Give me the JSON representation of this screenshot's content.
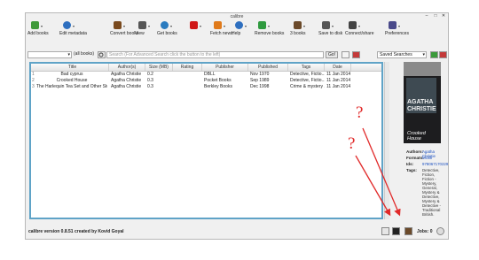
{
  "window": {
    "title": "calibre"
  },
  "toolbar": {
    "items": [
      {
        "label": "Add books",
        "icon": "add-book-icon",
        "color": "#3f9a3a"
      },
      {
        "label": "Edit metadata",
        "icon": "info-icon",
        "color": "#2e6fbf"
      },
      {
        "label": "Convert books",
        "icon": "convert-icon",
        "color": "#7a4a1e"
      },
      {
        "label": "View",
        "icon": "magnifier-icon",
        "color": "#555555"
      },
      {
        "label": "Get books",
        "icon": "globe-icon",
        "color": "#2a7bbf"
      },
      {
        "label": "",
        "icon": "heart-icon",
        "color": "#d01818"
      },
      {
        "label": "Fetch news",
        "icon": "news-icon",
        "color": "#e07a1a"
      },
      {
        "label": "Help",
        "icon": "help-icon",
        "color": "#2e6fbf"
      },
      {
        "label": "Remove books",
        "icon": "recycle-icon",
        "color": "#2f9a3f"
      },
      {
        "label": "3 books",
        "icon": "library-icon",
        "color": "#6b4a2a"
      },
      {
        "label": "Save to disk",
        "icon": "save-icon",
        "color": "#555555"
      },
      {
        "label": "Connect/share",
        "icon": "connect-icon",
        "color": "#444444"
      },
      {
        "label": "Preferences",
        "icon": "preferences-icon",
        "color": "#4a4a8a"
      }
    ]
  },
  "searchbar": {
    "library_select": "",
    "scope_select": "(all books)",
    "search_placeholder": "Search (For Advanced Search click the button to the left)",
    "go_label": "Go!",
    "saved_search": "Saved Searches"
  },
  "table": {
    "columns": [
      "Title",
      "Author(s)",
      "Size (MB)",
      "Rating",
      "Publisher",
      "Published",
      "Tags",
      "Date"
    ],
    "rows": [
      {
        "num": "1",
        "title": "Bad cyprus",
        "author": "Agatha Christie",
        "size": "0.2",
        "rating": "",
        "publisher": "DBLL",
        "published": "Nov 1970",
        "tags": "Detective, Fictio...",
        "date": "11 Jan 2014"
      },
      {
        "num": "2",
        "title": "Crooked House",
        "author": "Agatha Christie",
        "size": "0.3",
        "rating": "",
        "publisher": "Pocket Books",
        "published": "Sep 1989",
        "tags": "Detective, Fictio...",
        "date": "11 Jan 2014"
      },
      {
        "num": "3",
        "title": "The Harlequin Tea Set and Other Stories",
        "author": "Agatha Christie",
        "size": "0.3",
        "rating": "",
        "publisher": "Berkley Books",
        "published": "Dec 1998",
        "tags": "Crime & mystery ...",
        "date": "11 Jan 2014"
      }
    ]
  },
  "cover": {
    "author_line1": "AGATHA",
    "author_line2": "CHRISTIE",
    "title": "Crooked House"
  },
  "details": {
    "authors_label": "Authors:",
    "authors_value": "Agatha Christie",
    "formats_label": "Formats:",
    "formats_value": "MOBI",
    "ids_label": "Ids:",
    "ids_value": "9780671702298",
    "tags_label": "Tags:",
    "tags_value": "Detective, Fiction, Fiction - Mystery, General, Mystery & Detective, Mystery & Detective - Traditional British, Traditional"
  },
  "status": {
    "version": "calibre version 0.8.51 created by Kovid Goyal",
    "jobs": "Jobs: 0"
  },
  "annotations": {
    "mark": "?"
  }
}
